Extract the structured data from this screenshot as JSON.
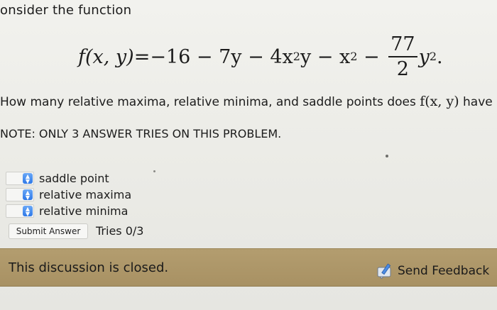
{
  "problem": {
    "intro": "onsider the function",
    "equation": {
      "lhs": "f(x, y)",
      "equals": " = ",
      "terms": "−16 − 7y − 4x",
      "exp1": "2",
      "mid": "y − x",
      "exp2": "2",
      "minus": " − ",
      "frac_num": "77",
      "frac_den": "2",
      "var": "y",
      "exp3": "2",
      "end": "."
    },
    "question_prefix": "How many relative maxima, relative minima, and saddle points does ",
    "question_fx": "f(x, y)",
    "question_suffix": " have",
    "note": "NOTE: ONLY 3 ANSWER TRIES ON THIS PROBLEM."
  },
  "answers": [
    {
      "label": "saddle point",
      "icon": "select-arrows-icon"
    },
    {
      "label": "relative maxima",
      "icon": "select-arrows-icon"
    },
    {
      "label": "relative minima",
      "icon": "select-arrows-icon"
    }
  ],
  "submit": {
    "label": "Submit Answer",
    "tries": "Tries 0/3"
  },
  "discussion": {
    "closed_text": "This discussion is closed.",
    "feedback_label": "Send Feedback",
    "feedback_icon": "feedback-pencil-icon"
  },
  "colors": {
    "accent_blue": "#2f79e8",
    "bar_tan": "#ac9566",
    "page_bg": "#ededea"
  }
}
